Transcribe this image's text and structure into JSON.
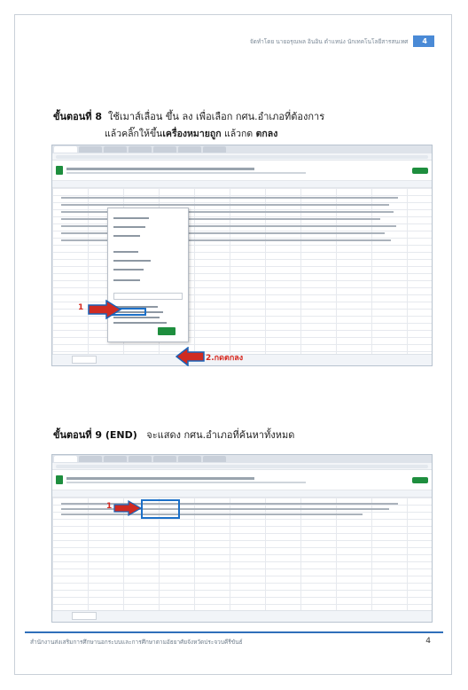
{
  "header": {
    "author": "จัดทำโดย นายอรุณพล อินอิน ตำแหน่ง นักเทคโนโลยีสารสนเทศ",
    "page_number": "4"
  },
  "step8": {
    "label": "ขั้นตอนที่ 8",
    "text": "ใช้เมาส์เลื่อน ขึ้น ลง เพื่อเลือก กศน.อำเภอที่ต้องการ",
    "sub_prefix": "แล้วคลิ๊กให้ขึ้น",
    "sub_bold1": "เครื่องหมายถูก",
    "sub_mid": " แล้วกด ",
    "sub_bold2": "ตกลง",
    "marker1": "1",
    "marker2": "2.กดตกลง"
  },
  "step9": {
    "label": "ขั้นตอนที่ 9 (END)",
    "text": "จะแสดง กศน.อำเภอที่ค้นหาทั้งหมด",
    "marker1": "1"
  },
  "footer": {
    "text": "สำนักงานส่งเสริมการศึกษานอกระบบและการศึกษาตามอัธยาศัยจังหวัดประจวบคีรีขันธ์",
    "page_number": "4"
  }
}
